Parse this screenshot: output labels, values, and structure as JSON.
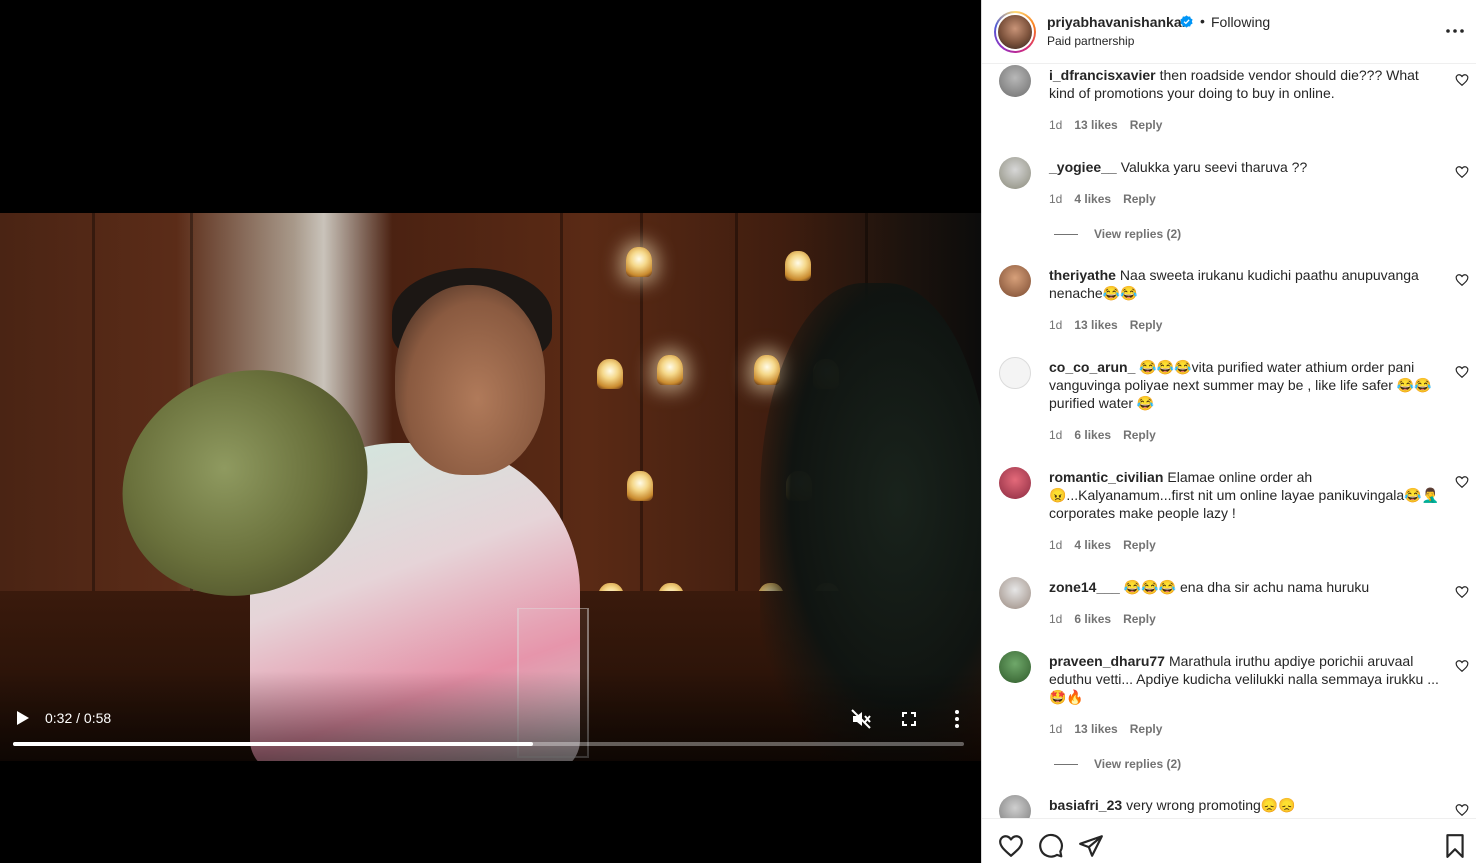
{
  "video": {
    "time": "0:32 / 0:58",
    "progress": 0.547
  },
  "post": {
    "username": "priyabhavanishankar",
    "separator": "•",
    "follow_state": "Following",
    "subtitle": "Paid partnership"
  },
  "comments": [
    {
      "user": "i_dfrancisxavier",
      "text": "then roadside vendor should die??? What kind of promotions your doing to buy in online.",
      "age": "1d",
      "likes": "13 likes",
      "reply": "Reply"
    },
    {
      "user": "_yogiee__",
      "text": "Valukka yaru seevi tharuva ??",
      "age": "1d",
      "likes": "4 likes",
      "reply": "Reply",
      "view_replies": "View replies (2)"
    },
    {
      "user": "theriyathe",
      "text": "Naa sweeta irukanu kudichi paathu anupuvanga nenache😂😂",
      "age": "1d",
      "likes": "13 likes",
      "reply": "Reply"
    },
    {
      "user": "co_co_arun_",
      "text": "😂😂😂vita purified water athium order pani vanguvinga poliyae next summer may be , like life safer 😂😂 purified water 😂",
      "age": "1d",
      "likes": "6 likes",
      "reply": "Reply"
    },
    {
      "user": "romantic_civilian",
      "text": "Elamae online order ah 😠...Kalyanamum...first nit um online layae panikuvingala😂🤦‍♂️ corporates make people lazy !",
      "age": "1d",
      "likes": "4 likes",
      "reply": "Reply"
    },
    {
      "user": "zone14___",
      "text": "😂😂😂 ena dha sir achu nama huruku",
      "age": "1d",
      "likes": "6 likes",
      "reply": "Reply"
    },
    {
      "user": "praveen_dharu77",
      "text": "Marathula iruthu apdiye porichii aruvaal eduthu vetti... Apdiye kudicha velilukki nalla semmaya irukku ... 🤩🔥",
      "age": "1d",
      "likes": "13 likes",
      "reply": "Reply",
      "view_replies": "View replies (2)"
    },
    {
      "user": "basiafri_23",
      "text": "very wrong promoting😞😞"
    }
  ],
  "icons": {
    "play": "play-icon",
    "mute": "volume-muted-icon",
    "fullscreen": "fullscreen-icon",
    "video_more": "more-vertical-icon",
    "post_more": "more-horizontal-icon",
    "verified": "verified-badge-icon",
    "like": "heart-icon",
    "comment": "comment-icon",
    "share": "share-icon",
    "save": "bookmark-icon"
  },
  "colors": {
    "verified": "#0095f6",
    "meta_text": "#737373",
    "text": "#262626"
  }
}
